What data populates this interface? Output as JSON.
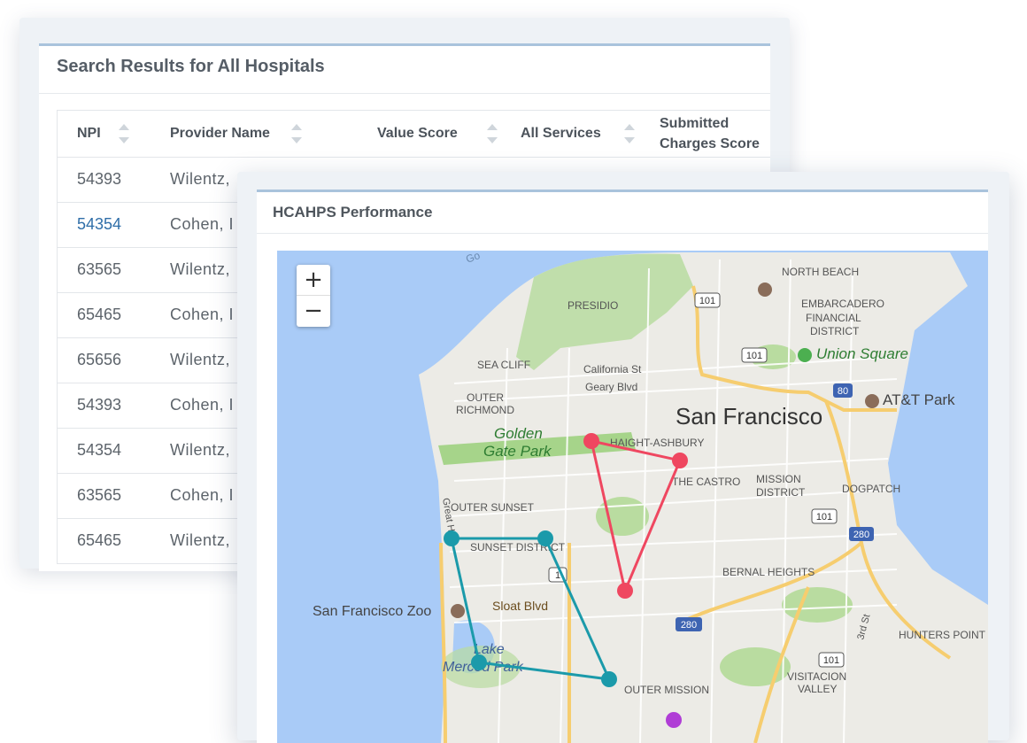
{
  "search_panel": {
    "title": "Search Results for All Hospitals",
    "columns": [
      "NPI",
      "Provider Name",
      "Value Score",
      "All Services",
      "Submitted",
      "Charges Score"
    ],
    "rows": [
      {
        "npi": "54393",
        "provider": "Wilentz,"
      },
      {
        "npi": "54354",
        "provider": "Cohen, I"
      },
      {
        "npi": "63565",
        "provider": "Wilentz,"
      },
      {
        "npi": "65465",
        "provider": "Cohen, I"
      },
      {
        "npi": "65656",
        "provider": "Wilentz,"
      },
      {
        "npi": "54393",
        "provider": "Cohen, I"
      },
      {
        "npi": "54354",
        "provider": "Wilentz,"
      },
      {
        "npi": "63565",
        "provider": "Cohen, I"
      },
      {
        "npi": "65465",
        "provider": "Wilentz,"
      }
    ]
  },
  "hcahps_panel": {
    "title": "HCAHPS Performance",
    "zoom_in": "+",
    "zoom_out": "−",
    "map_labels": {
      "north_beach": "NORTH BEACH",
      "embarcadero": "EMBARCADERO",
      "financial": "FINANCIAL",
      "district": "DISTRICT",
      "presidio": "PRESIDIO",
      "union_square": "Union Square",
      "sea_cliff": "SEA CLIFF",
      "california": "California St",
      "geary": "Geary Blvd",
      "outer": "OUTER",
      "richmond": "RICHMOND",
      "att_park": "AT&T Park",
      "san_francisco": "San Francisco",
      "golden": "Golden",
      "gate_park": "Gate Park",
      "haight": "HAIGHT-ASHBURY",
      "castro": "THE CASTRO",
      "mission": "MISSION",
      "mission_district": "DISTRICT",
      "dogpatch": "DOGPATCH",
      "great_hwy": "Great Hwy",
      "outer_sunset": "OUTER SUNSET",
      "sunset_district": "SUNSET DISTRICT",
      "bernal": "BERNAL HEIGHTS",
      "zoo": "San Francisco Zoo",
      "sloat": "Sloat Blvd",
      "third": "3rd St",
      "hunters": "HUNTERS POINT",
      "lake": "Lake",
      "merced": "Merced Park",
      "outer_mission": "OUTER MISSION",
      "visitacion": "VISITACION",
      "valley": "VALLEY",
      "go": "Go",
      "shield_101": "101",
      "shield_80": "80",
      "shield_280": "280",
      "shield_1": "1"
    },
    "routes": [
      {
        "color": "#ef4760"
      },
      {
        "color": "#1b9aaa"
      },
      {
        "color": "#b03dd6"
      }
    ]
  }
}
